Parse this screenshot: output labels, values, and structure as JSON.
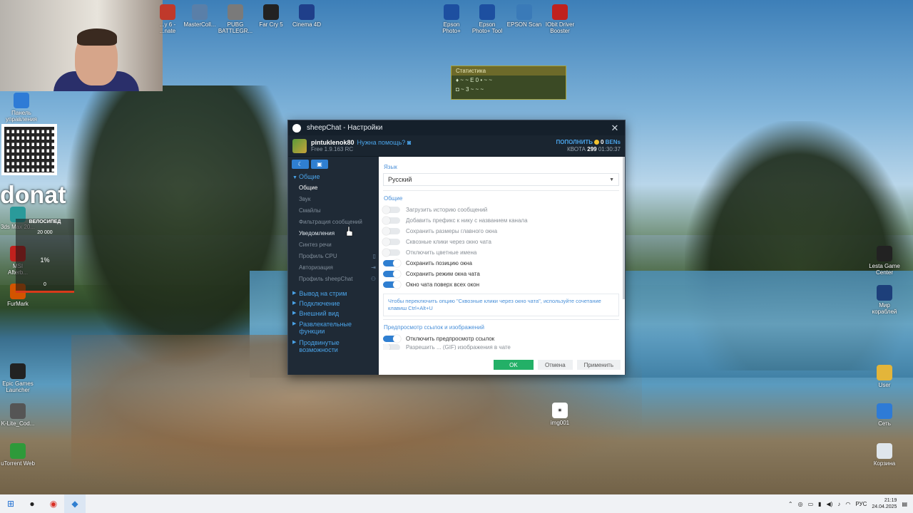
{
  "desktop": {
    "icons_top": [
      {
        "label": "...y 6 -\n...nate",
        "icon": "game-icon",
        "color": "#c0392b"
      },
      {
        "label": "MasterColl...",
        "icon": "collection-icon",
        "color": "#5a7fa8"
      },
      {
        "label": "PUBG\nBATTLEGR...",
        "icon": "pubg-icon",
        "color": "#7a7a7a"
      },
      {
        "label": "Far Cry 5",
        "icon": "farcry-icon",
        "color": "#222"
      },
      {
        "label": "Cinema 4D",
        "icon": "cinema4d-icon",
        "color": "#1f3f8a"
      },
      {
        "label": "Epson\nPhoto+",
        "icon": "epson-photo-icon",
        "color": "#1d4fa0"
      },
      {
        "label": "Epson\nPhoto+ Tool",
        "icon": "epson-tool-icon",
        "color": "#1d4fa0"
      },
      {
        "label": "EPSON Scan",
        "icon": "epson-scan-icon",
        "color": "#3a7ab8"
      },
      {
        "label": "IObit Driver\nBooster",
        "icon": "iobit-icon",
        "color": "#c0211d"
      }
    ],
    "icons_left": [
      {
        "label": "Панель\nуправления",
        "icon": "control-panel-icon",
        "color": "#2e7bd6"
      },
      {
        "label": "3ds Max 20...",
        "icon": "3dsmax-icon",
        "color": "#2a9a9a"
      },
      {
        "label": "MSI\nAfterb...",
        "icon": "msi-icon",
        "color": "#c0211d"
      },
      {
        "label": "FurMark",
        "icon": "furmark-icon",
        "color": "#d35400"
      },
      {
        "label": "Epic Games\nLauncher",
        "icon": "epic-icon",
        "color": "#222"
      },
      {
        "label": "K-Lite_Cod...",
        "icon": "klite-icon",
        "color": "#555"
      },
      {
        "label": "uTorrent Web",
        "icon": "utorrent-icon",
        "color": "#2e9a3a"
      }
    ],
    "icons_right": [
      {
        "label": "Lesta Game\nCenter",
        "icon": "lesta-icon",
        "color": "#222"
      },
      {
        "label": "Мир\nкораблей",
        "icon": "ships-icon",
        "color": "#1d3f7a"
      },
      {
        "label": "User",
        "icon": "user-folder-icon",
        "color": "#e3b53a"
      },
      {
        "label": "Сеть",
        "icon": "network-icon",
        "color": "#2e7bd6"
      },
      {
        "label": "Корзина",
        "icon": "recycle-bin-icon",
        "color": "#dfe6ec"
      }
    ],
    "img_icon": {
      "label": "img001"
    },
    "donat_text": "donat",
    "velo": {
      "title": "ВЕЛОСИПЕД",
      "top": "20 000",
      "percent": "1%",
      "bottom": "0"
    }
  },
  "stats_widget": {
    "title": "Статистика",
    "line1": "♦ ~ ~ E 0 • ~ ~",
    "line2": "◘ ~ 3 ~ ~ ~"
  },
  "window": {
    "title": "sheepChat - Настройки",
    "user": {
      "name": "pintuklenok80",
      "help": "Нужна помощь?",
      "version": "Free 1.9.163 RC"
    },
    "quota": {
      "topup": "ПОПОЛНИТЬ",
      "balance": "0",
      "currency": "ВЕNs",
      "quota_label": "КВОТА",
      "quota_value": "299",
      "time": "01:30:37"
    },
    "sidebar": {
      "general_section": "Общие",
      "items": [
        {
          "label": "Общие",
          "state": "active"
        },
        {
          "label": "Звук",
          "state": "normal"
        },
        {
          "label": "Смайлы",
          "state": "normal"
        },
        {
          "label": "Фильтрация сообщений",
          "state": "normal"
        },
        {
          "label": "Уведомления",
          "state": "bright"
        },
        {
          "label": "Синтез речи",
          "state": "normal"
        },
        {
          "label": "Профиль CPU",
          "state": "normal",
          "right_icon": "phone-icon",
          "right_glyph": "▯"
        },
        {
          "label": "Авторизация",
          "state": "normal",
          "right_icon": "login-icon",
          "right_glyph": "⇥"
        },
        {
          "label": "Профиль sheepChat",
          "state": "normal",
          "right_icon": "person-icon",
          "right_glyph": "⚇"
        }
      ],
      "sections": [
        "Вывод на стрим",
        "Подключение",
        "Внешний вид",
        "Развлекательные функции",
        "Продвинутые возможности"
      ]
    },
    "content": {
      "lang_group": "Язык",
      "lang_value": "Русский",
      "general_group": "Общие",
      "toggles": [
        {
          "label": "Загрузить историю сообщений",
          "on": false
        },
        {
          "label": "Добавить префикс к нику с названием канала",
          "on": false
        },
        {
          "label": "Сохранить размеры главного окна",
          "on": false
        },
        {
          "label": "Сквозные клики через окно чата",
          "on": false
        },
        {
          "label": "Отключить цветные имена",
          "on": false
        },
        {
          "label": "Сохранить позицию окна",
          "on": true
        },
        {
          "label": "Сохранить режим окна чата",
          "on": true
        },
        {
          "label": "Окно чата поверх всех окон",
          "on": true
        }
      ],
      "hint": "Чтобы переключить опцию \"Сквозные клики через окно чата\", используйте сочетание клавиш Ctrl+Alt+U",
      "preview_group": "Предпросмотр ссылок и изображений",
      "preview_toggle": {
        "label": "Отключить предпросмотр ссылок",
        "on": true
      },
      "cut_text": "Разрешить ... (GIF) изображения в чате"
    },
    "buttons": {
      "ok": "OK",
      "cancel": "Отмена",
      "apply": "Применить"
    }
  },
  "taskbar": {
    "lang": "РУС",
    "time": "21:19",
    "date": "24.04.2025"
  }
}
